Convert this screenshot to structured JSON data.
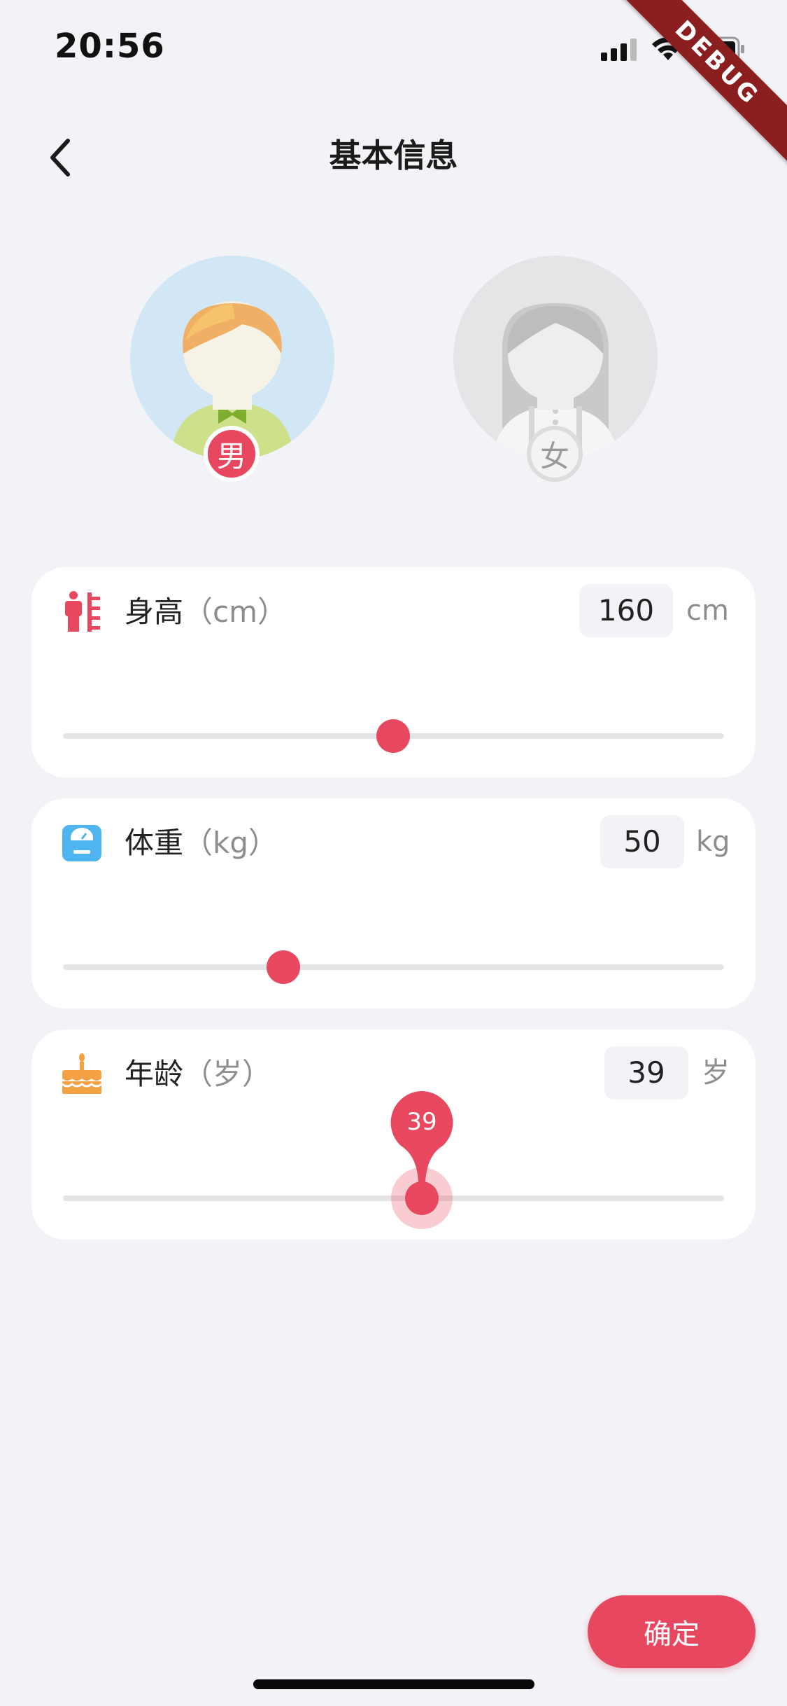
{
  "status_bar": {
    "time": "20:56",
    "debug": "DEBUG"
  },
  "header": {
    "title": "基本信息"
  },
  "gender": {
    "male_label": "男",
    "female_label": "女",
    "selected": "male"
  },
  "height": {
    "label": "身高",
    "unit_paren": "（cm）",
    "value": "160",
    "unit": "cm",
    "slider_fraction": 0.5,
    "icon": "height-ruler-icon"
  },
  "weight": {
    "label": "体重",
    "unit_paren": "（kg）",
    "value": "50",
    "unit": "kg",
    "slider_fraction": 0.333,
    "icon": "scale-icon"
  },
  "age": {
    "label": "年龄",
    "unit_paren": "（岁）",
    "value": "39",
    "unit": "岁",
    "slider_fraction": 0.543,
    "indicator": "39",
    "icon": "cake-icon"
  },
  "colors": {
    "accent": "#e8485f",
    "background": "#f2f3f7",
    "male_bg": "#d1e7f5",
    "female_bg": "#e5e5e7"
  },
  "confirm": {
    "label": "确定"
  }
}
